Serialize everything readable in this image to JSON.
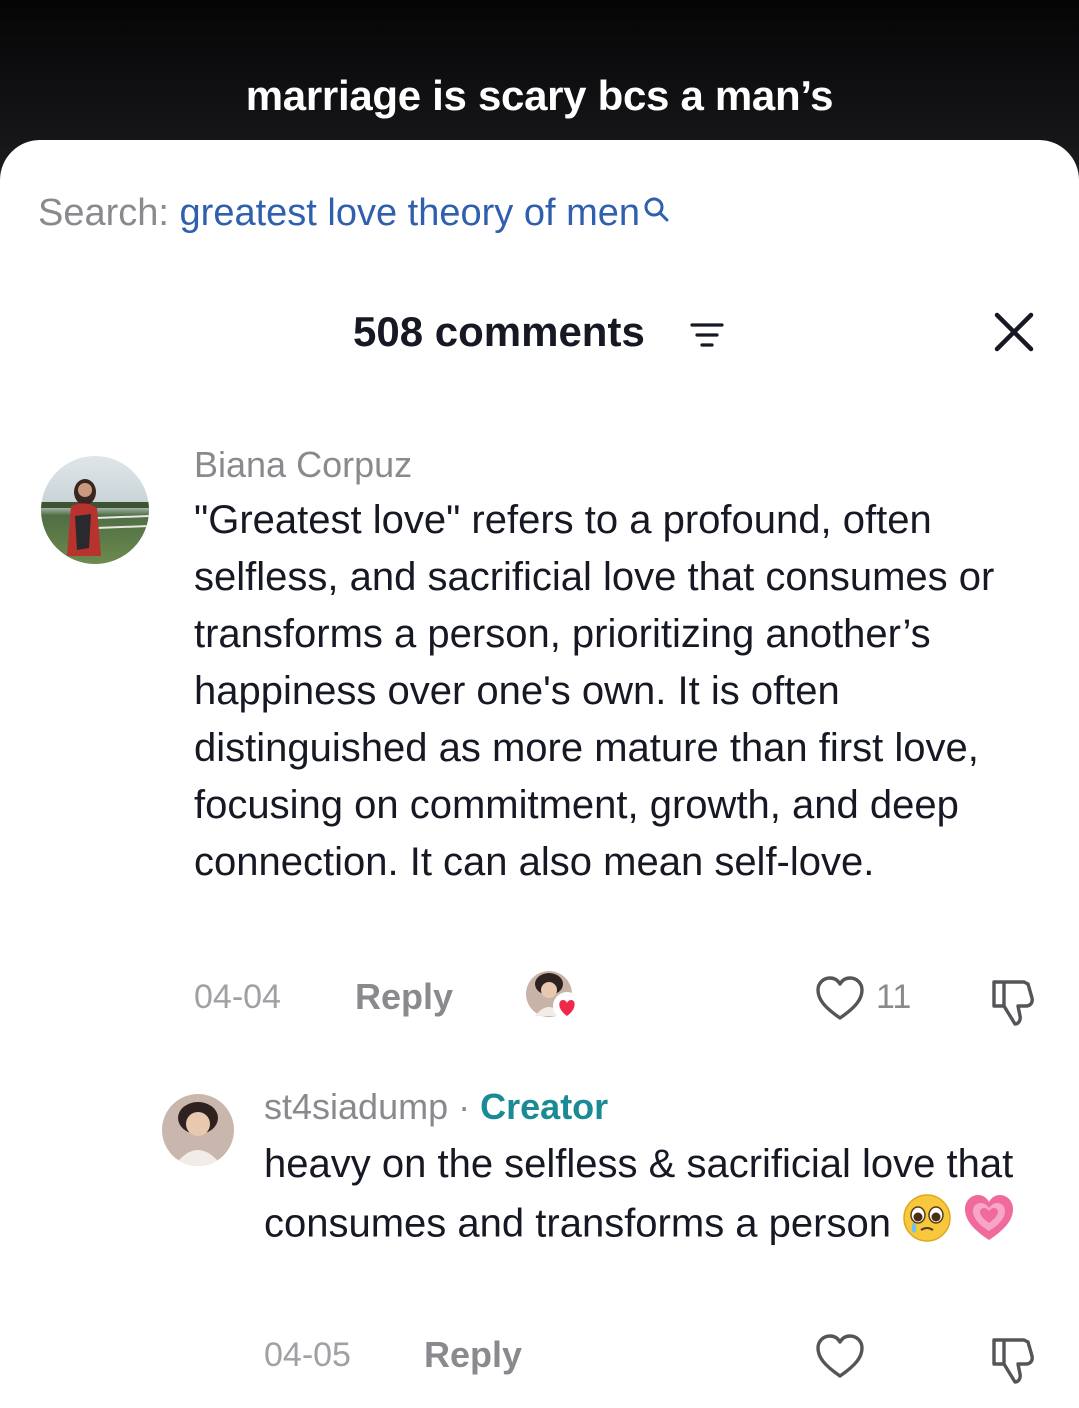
{
  "video": {
    "caption_line1": "marriage is scary bcs a man’s"
  },
  "search": {
    "label": "Search:",
    "query": "greatest love theory of men"
  },
  "comments_header": {
    "count_label": "508 comments"
  },
  "comments": [
    {
      "username": "Biana Corpuz",
      "text": "\"Greatest love\" refers to a profound, often selfless, and sacrificial love that consumes or transforms a person, prioritizing another’s happiness over one's own. It is often distinguished as more mature than first love, focusing on commitment, growth, and deep connection. It can also mean self-love.",
      "date": "04-04",
      "reply_label": "Reply",
      "like_count": "11"
    }
  ],
  "replies": [
    {
      "username": "st4siadump",
      "separator": "·",
      "badge": "Creator",
      "text": "heavy on the selfless & sacrificial love that consumes and transforms a person",
      "emojis": [
        "pleading-face-emoji",
        "growing-heart-emoji"
      ],
      "date": "04-05",
      "reply_label": "Reply"
    }
  ],
  "colors": {
    "search_query": "#2f5fad",
    "creator_badge": "#1a8a94",
    "like_heart_badge": "#f0284a"
  }
}
